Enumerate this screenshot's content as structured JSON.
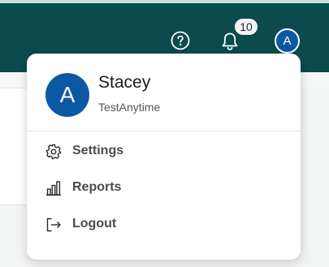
{
  "header": {
    "help_icon": "help-circle-icon",
    "notifications_icon": "bell-icon",
    "notification_count": "10",
    "avatar_initial": "A"
  },
  "user_menu": {
    "avatar_initial": "A",
    "name": "Stacey",
    "organization": "TestAnytime",
    "items": [
      {
        "label": "Settings",
        "icon": "gear-icon"
      },
      {
        "label": "Reports",
        "icon": "bar-chart-icon"
      },
      {
        "label": "Logout",
        "icon": "logout-icon"
      }
    ]
  },
  "colors": {
    "header_bg": "#0b4a4d",
    "avatar_bg": "#0b59a4"
  }
}
